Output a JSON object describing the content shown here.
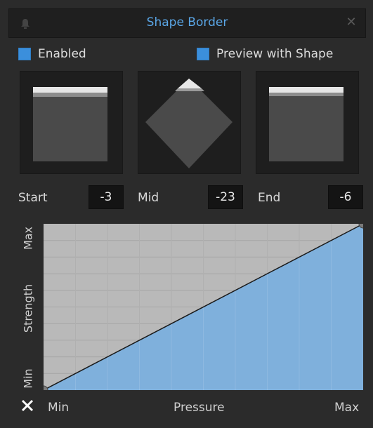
{
  "window": {
    "title": "Shape Border"
  },
  "options": {
    "enabled_label": "Enabled",
    "enabled_checked": true,
    "preview_label": "Preview with Shape",
    "preview_checked": true
  },
  "params": {
    "start_label": "Start",
    "start_value": "-3",
    "mid_label": "Mid",
    "mid_value": "-23",
    "end_label": "End",
    "end_value": "-6"
  },
  "curve": {
    "y_max_label": "Max",
    "y_axis_label": "Strength",
    "y_min_label": "Min",
    "x_min_label": "Min",
    "x_axis_label": "Pressure",
    "x_max_label": "Max",
    "points": [
      [
        0,
        0
      ],
      [
        1,
        1
      ]
    ],
    "fill_color": "#7fb0dc",
    "background_color": "#b9b9b9"
  },
  "icons": {
    "bell": "bell-icon",
    "close": "close-icon",
    "reset": "x-icon"
  }
}
